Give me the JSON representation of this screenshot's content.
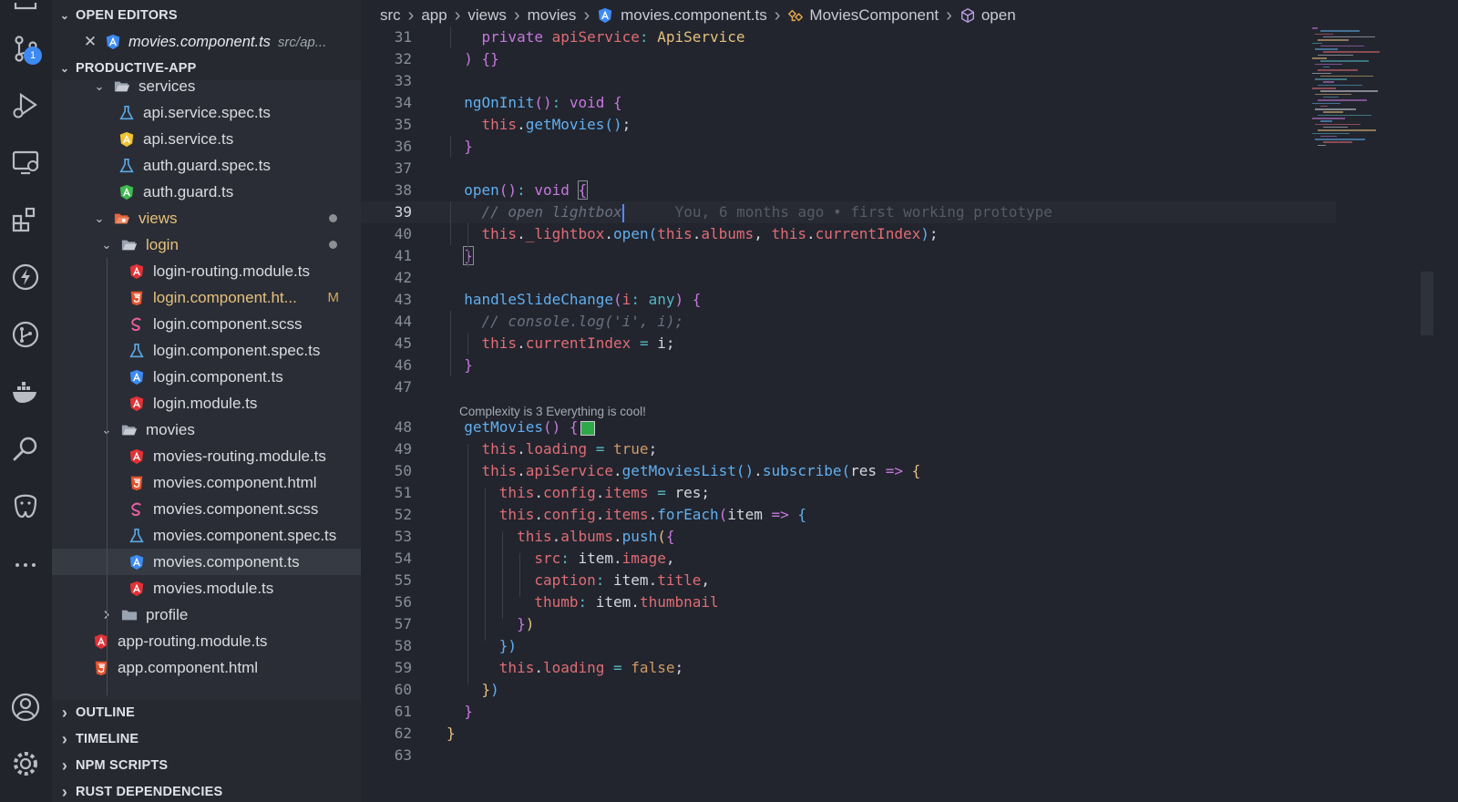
{
  "activity_bar": {
    "items": [
      {
        "name": "explorer-icon"
      },
      {
        "name": "source-control-icon"
      },
      {
        "name": "run-debug-icon"
      },
      {
        "name": "remote-explorer-icon"
      },
      {
        "name": "extensions-icon"
      },
      {
        "name": "thunder-client-icon"
      },
      {
        "name": "git-graph-icon"
      },
      {
        "name": "docker-icon"
      },
      {
        "name": "search-icon"
      },
      {
        "name": "postgres-icon"
      },
      {
        "name": "more-icon"
      },
      {
        "name": "accounts-icon"
      },
      {
        "name": "settings-gear-icon"
      }
    ],
    "source_control_badge": "1"
  },
  "sidebar": {
    "open_editors": {
      "title": "OPEN EDITORS",
      "items": [
        {
          "name": "movies.component.ts",
          "path": "src/ap...",
          "icon": "angular-blue"
        }
      ]
    },
    "project": {
      "title": "PRODUCTIVE-APP",
      "rows": [
        {
          "label": "services",
          "type": "folder-open",
          "depth": 1
        },
        {
          "label": "api.service.spec.ts",
          "type": "spec",
          "depth": 2
        },
        {
          "label": "api.service.ts",
          "type": "angular-yellow",
          "depth": 2
        },
        {
          "label": "auth.guard.spec.ts",
          "type": "spec",
          "depth": 2
        },
        {
          "label": "auth.guard.ts",
          "type": "angular-green",
          "depth": 2
        },
        {
          "label": "views",
          "type": "folder-views",
          "depth": 1,
          "dot": true
        },
        {
          "label": "login",
          "type": "folder-open",
          "depth": 2,
          "dot": true
        },
        {
          "label": "login-routing.module.ts",
          "type": "angular-red",
          "depth": 3
        },
        {
          "label": "login.component.ht...",
          "type": "html",
          "depth": 3,
          "modified": "M"
        },
        {
          "label": "login.component.scss",
          "type": "scss",
          "depth": 3
        },
        {
          "label": "login.component.spec.ts",
          "type": "spec",
          "depth": 3
        },
        {
          "label": "login.component.ts",
          "type": "angular-blue",
          "depth": 3
        },
        {
          "label": "login.module.ts",
          "type": "angular-red",
          "depth": 3
        },
        {
          "label": "movies",
          "type": "folder-open",
          "depth": 2
        },
        {
          "label": "movies-routing.module.ts",
          "type": "angular-red",
          "depth": 3
        },
        {
          "label": "movies.component.html",
          "type": "html",
          "depth": 3
        },
        {
          "label": "movies.component.scss",
          "type": "scss",
          "depth": 3
        },
        {
          "label": "movies.component.spec.ts",
          "type": "spec",
          "depth": 3
        },
        {
          "label": "movies.component.ts",
          "type": "angular-blue",
          "depth": 3,
          "selected": true
        },
        {
          "label": "movies.module.ts",
          "type": "angular-red",
          "depth": 3
        },
        {
          "label": "profile",
          "type": "folder-closed",
          "depth": 2
        },
        {
          "label": "app-routing.module.ts",
          "type": "angular-red",
          "depth": 1
        },
        {
          "label": "app.component.html",
          "type": "html",
          "depth": 1
        }
      ]
    },
    "collapsed_sections": [
      "OUTLINE",
      "TIMELINE",
      "NPM SCRIPTS",
      "RUST DEPENDENCIES"
    ]
  },
  "breadcrumb": {
    "parts": [
      "src",
      "app",
      "views",
      "movies",
      "movies.component.ts",
      "MoviesComponent",
      "open"
    ]
  },
  "editor": {
    "current_line": 39,
    "codelens": "Complexity is 3 Everything is cool!",
    "blame": "You, 6 months ago • first working prototype",
    "lines": [
      {
        "n": 31,
        "tokens": [
          [
            "tx",
            "  "
          ],
          [
            "kw",
            "private "
          ],
          [
            "pr",
            "apiService"
          ],
          [
            "op",
            ": "
          ],
          [
            "ty",
            "ApiService"
          ]
        ]
      },
      {
        "n": 32,
        "tokens": [
          [
            "b2",
            ") "
          ],
          [
            "b2",
            "{}"
          ]
        ]
      },
      {
        "n": 33,
        "tokens": []
      },
      {
        "n": 34,
        "tokens": [
          [
            "fn",
            "ngOnInit"
          ],
          [
            "b2",
            "()"
          ],
          [
            "op",
            ": "
          ],
          [
            "kw",
            "void "
          ],
          [
            "b2",
            "{"
          ]
        ]
      },
      {
        "n": 35,
        "tokens": [
          [
            "tx",
            "  "
          ],
          [
            "th",
            "this"
          ],
          [
            "tx",
            "."
          ],
          [
            "fn",
            "getMovies"
          ],
          [
            "b3",
            "()"
          ],
          [
            "tx",
            ";"
          ]
        ]
      },
      {
        "n": 36,
        "tokens": [
          [
            "b2",
            "}"
          ]
        ]
      },
      {
        "n": 37,
        "tokens": []
      },
      {
        "n": 38,
        "tokens": [
          [
            "fn",
            "open"
          ],
          [
            "b2",
            "()"
          ],
          [
            "op",
            ": "
          ],
          [
            "kw",
            "void "
          ],
          [
            "b2",
            "{"
          ]
        ]
      },
      {
        "n": 39,
        "tokens": [
          [
            "tx",
            "  "
          ],
          [
            "cm",
            "// open lightbox"
          ]
        ]
      },
      {
        "n": 40,
        "tokens": [
          [
            "tx",
            "  "
          ],
          [
            "th",
            "this"
          ],
          [
            "tx",
            "."
          ],
          [
            "pr",
            "_lightbox"
          ],
          [
            "tx",
            "."
          ],
          [
            "fn",
            "open"
          ],
          [
            "b3",
            "("
          ],
          [
            "th",
            "this"
          ],
          [
            "tx",
            "."
          ],
          [
            "pr",
            "albums"
          ],
          [
            "tx",
            ", "
          ],
          [
            "th",
            "this"
          ],
          [
            "tx",
            "."
          ],
          [
            "pr",
            "currentIndex"
          ],
          [
            "b3",
            ")"
          ],
          [
            "tx",
            ";"
          ]
        ]
      },
      {
        "n": 41,
        "tokens": [
          [
            "b2",
            "}"
          ]
        ]
      },
      {
        "n": 42,
        "tokens": []
      },
      {
        "n": 43,
        "tokens": [
          [
            "fn",
            "handleSlideChange"
          ],
          [
            "b2",
            "("
          ],
          [
            "pr",
            "i"
          ],
          [
            "op",
            ": "
          ],
          [
            "op",
            "any"
          ],
          [
            "b2",
            ") "
          ],
          [
            "b2",
            "{"
          ]
        ]
      },
      {
        "n": 44,
        "tokens": [
          [
            "tx",
            "  "
          ],
          [
            "cm",
            "// console.log('i', i);"
          ]
        ]
      },
      {
        "n": 45,
        "tokens": [
          [
            "tx",
            "  "
          ],
          [
            "th",
            "this"
          ],
          [
            "tx",
            "."
          ],
          [
            "pr",
            "currentIndex "
          ],
          [
            "op",
            "= "
          ],
          [
            "tx",
            "i;"
          ]
        ]
      },
      {
        "n": 46,
        "tokens": [
          [
            "b2",
            "}"
          ]
        ]
      },
      {
        "n": 47,
        "tokens": []
      },
      {
        "n": 48,
        "tokens": [
          [
            "fn",
            "getMovies"
          ],
          [
            "b2",
            "() "
          ],
          [
            "b2",
            "{"
          ]
        ]
      },
      {
        "n": 49,
        "tokens": [
          [
            "tx",
            "  "
          ],
          [
            "th",
            "this"
          ],
          [
            "tx",
            "."
          ],
          [
            "pr",
            "loading "
          ],
          [
            "op",
            "= "
          ],
          [
            "bl",
            "true"
          ],
          [
            "tx",
            ";"
          ]
        ]
      },
      {
        "n": 50,
        "tokens": [
          [
            "tx",
            "  "
          ],
          [
            "th",
            "this"
          ],
          [
            "tx",
            "."
          ],
          [
            "pr",
            "apiService"
          ],
          [
            "tx",
            "."
          ],
          [
            "fn",
            "getMoviesList"
          ],
          [
            "b3",
            "()"
          ],
          [
            "tx",
            "."
          ],
          [
            "fn",
            "subscribe"
          ],
          [
            "b3",
            "("
          ],
          [
            "tx",
            "res "
          ],
          [
            "kw",
            "=> "
          ],
          [
            "b1",
            "{"
          ]
        ]
      },
      {
        "n": 51,
        "tokens": [
          [
            "tx",
            "    "
          ],
          [
            "th",
            "this"
          ],
          [
            "tx",
            "."
          ],
          [
            "pr",
            "config"
          ],
          [
            "tx",
            "."
          ],
          [
            "pr",
            "items "
          ],
          [
            "op",
            "= "
          ],
          [
            "tx",
            "res;"
          ]
        ]
      },
      {
        "n": 52,
        "tokens": [
          [
            "tx",
            "    "
          ],
          [
            "th",
            "this"
          ],
          [
            "tx",
            "."
          ],
          [
            "pr",
            "config"
          ],
          [
            "tx",
            "."
          ],
          [
            "pr",
            "items"
          ],
          [
            "tx",
            "."
          ],
          [
            "fn",
            "forEach"
          ],
          [
            "b2",
            "("
          ],
          [
            "tx",
            "item "
          ],
          [
            "kw",
            "=> "
          ],
          [
            "b3",
            "{"
          ]
        ]
      },
      {
        "n": 53,
        "tokens": [
          [
            "tx",
            "      "
          ],
          [
            "th",
            "this"
          ],
          [
            "tx",
            "."
          ],
          [
            "pr",
            "albums"
          ],
          [
            "tx",
            "."
          ],
          [
            "fn",
            "push"
          ],
          [
            "b1",
            "("
          ],
          [
            "b2",
            "{"
          ]
        ]
      },
      {
        "n": 54,
        "tokens": [
          [
            "tx",
            "        "
          ],
          [
            "pr",
            "src"
          ],
          [
            "op",
            ": "
          ],
          [
            "tx",
            "item."
          ],
          [
            "pr",
            "image"
          ],
          [
            "tx",
            ","
          ]
        ]
      },
      {
        "n": 55,
        "tokens": [
          [
            "tx",
            "        "
          ],
          [
            "pr",
            "caption"
          ],
          [
            "op",
            ": "
          ],
          [
            "tx",
            "item."
          ],
          [
            "pr",
            "title"
          ],
          [
            "tx",
            ","
          ]
        ]
      },
      {
        "n": 56,
        "tokens": [
          [
            "tx",
            "        "
          ],
          [
            "pr",
            "thumb"
          ],
          [
            "op",
            ": "
          ],
          [
            "tx",
            "item."
          ],
          [
            "pr",
            "thumbnail"
          ]
        ]
      },
      {
        "n": 57,
        "tokens": [
          [
            "tx",
            "      "
          ],
          [
            "b2",
            "}"
          ],
          [
            "b1",
            ")"
          ]
        ]
      },
      {
        "n": 58,
        "tokens": [
          [
            "tx",
            "    "
          ],
          [
            "b3",
            "})"
          ]
        ]
      },
      {
        "n": 59,
        "tokens": [
          [
            "tx",
            "    "
          ],
          [
            "th",
            "this"
          ],
          [
            "tx",
            "."
          ],
          [
            "pr",
            "loading "
          ],
          [
            "op",
            "= "
          ],
          [
            "bl",
            "false"
          ],
          [
            "tx",
            ";"
          ]
        ]
      },
      {
        "n": 60,
        "tokens": [
          [
            "tx",
            "  "
          ],
          [
            "b1",
            "}"
          ],
          [
            "b3",
            ")"
          ]
        ]
      },
      {
        "n": 61,
        "tokens": [
          [
            "b2",
            "}"
          ]
        ]
      },
      {
        "n": 62,
        "tokens": [
          [
            "b1",
            "}"
          ]
        ]
      },
      {
        "n": 63,
        "tokens": []
      }
    ]
  },
  "colors": {
    "angular_red": "#e23237",
    "angular_blue": "#3d8bf2",
    "angular_yellow": "#f2c230",
    "angular_green": "#3fb950",
    "spec": "#5aa9e6",
    "html": "#e5532d",
    "scss": "#e85fa0",
    "folder": "#9aa3b0",
    "folder_views": "#e8643c",
    "modified": "#d7a95b"
  }
}
